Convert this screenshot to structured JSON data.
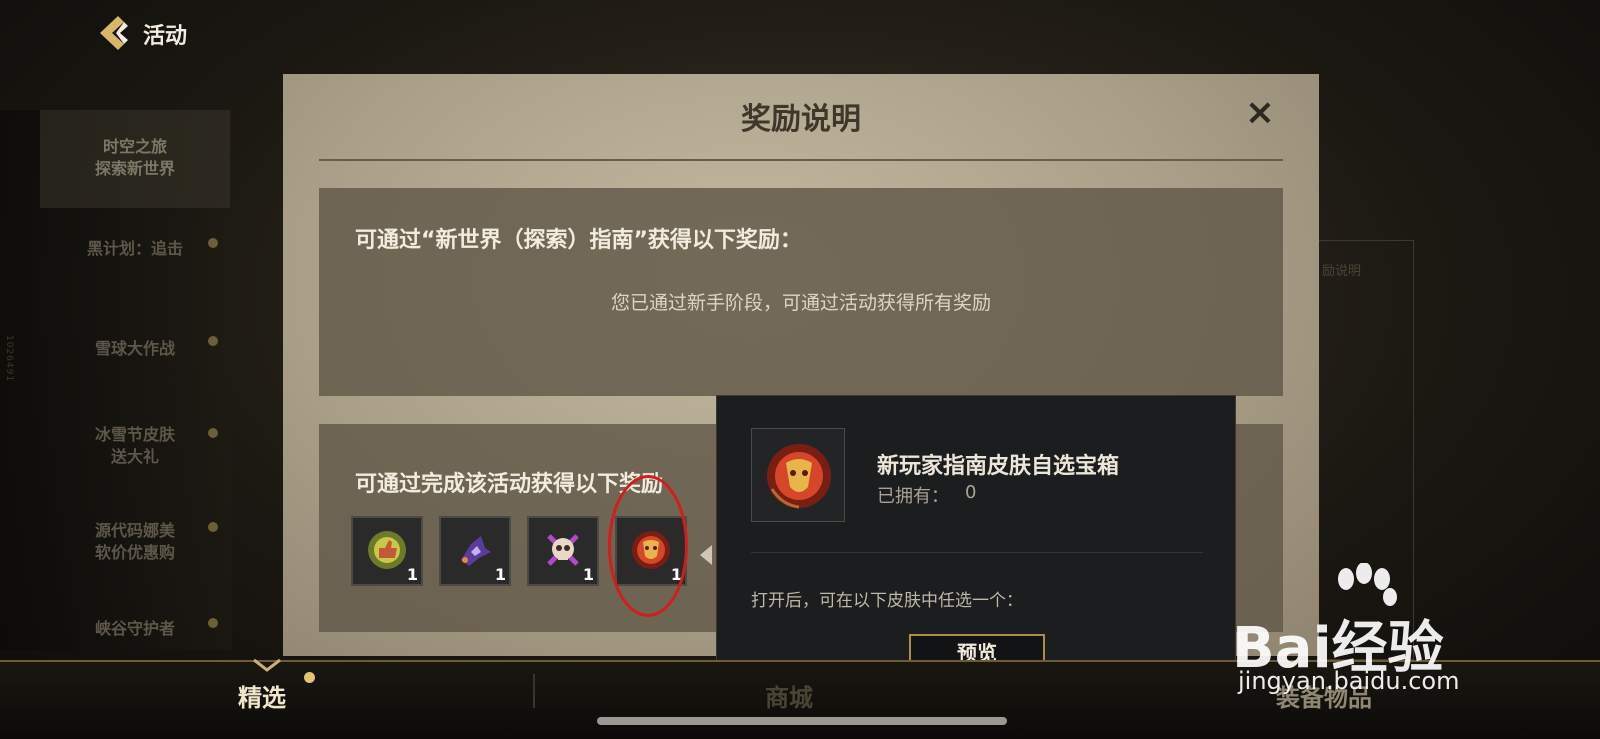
{
  "header": {
    "title": "活动"
  },
  "sidebar": {
    "items": [
      {
        "label": "时空之旅\n探索新世界"
      },
      {
        "label": "黑计划：追击"
      },
      {
        "label": "雪球大作战"
      },
      {
        "label": "冰雪节皮肤\n送大礼"
      },
      {
        "label": "源代码娜美\n软价优惠购"
      },
      {
        "label": "峡谷守护者"
      }
    ],
    "vertical_code": "1026491"
  },
  "modal": {
    "title": "奖励说明",
    "close_label": "×",
    "section1": {
      "heading": "可通过“新世界（探索）指南”获得以下奖励：",
      "note": "您已通过新手阶段，可通过活动获得所有奖励"
    },
    "section2": {
      "heading": "可通过完成该活动获得以下奖励",
      "rewards": [
        {
          "icon": "thumbs-up-emote-icon",
          "qty": "1"
        },
        {
          "icon": "dragon-ward-icon",
          "qty": "1"
        },
        {
          "icon": "skull-emblem-icon",
          "qty": "1"
        },
        {
          "icon": "skin-chest-icon",
          "qty": "1"
        }
      ]
    }
  },
  "popup": {
    "item_name": "新玩家指南皮肤自选宝箱",
    "owned_label": "已拥有：",
    "owned_value": "0",
    "description": "打开后，可在以下皮肤中任选一个：",
    "preview_button": "预览"
  },
  "right_panel_ghost": {
    "label": "励说明"
  },
  "bottom_tabs": [
    {
      "label": "精选",
      "active": true
    },
    {
      "label": "商城",
      "active": false
    },
    {
      "label": "装备物品",
      "active": false
    }
  ],
  "watermark": {
    "main": "Bai经验",
    "sub": "jingyan.baidu.com"
  },
  "colors": {
    "accent_gold": "#b08b4a",
    "highlight_circle": "#d51c1c",
    "modal_bg": "#b0a58e"
  }
}
